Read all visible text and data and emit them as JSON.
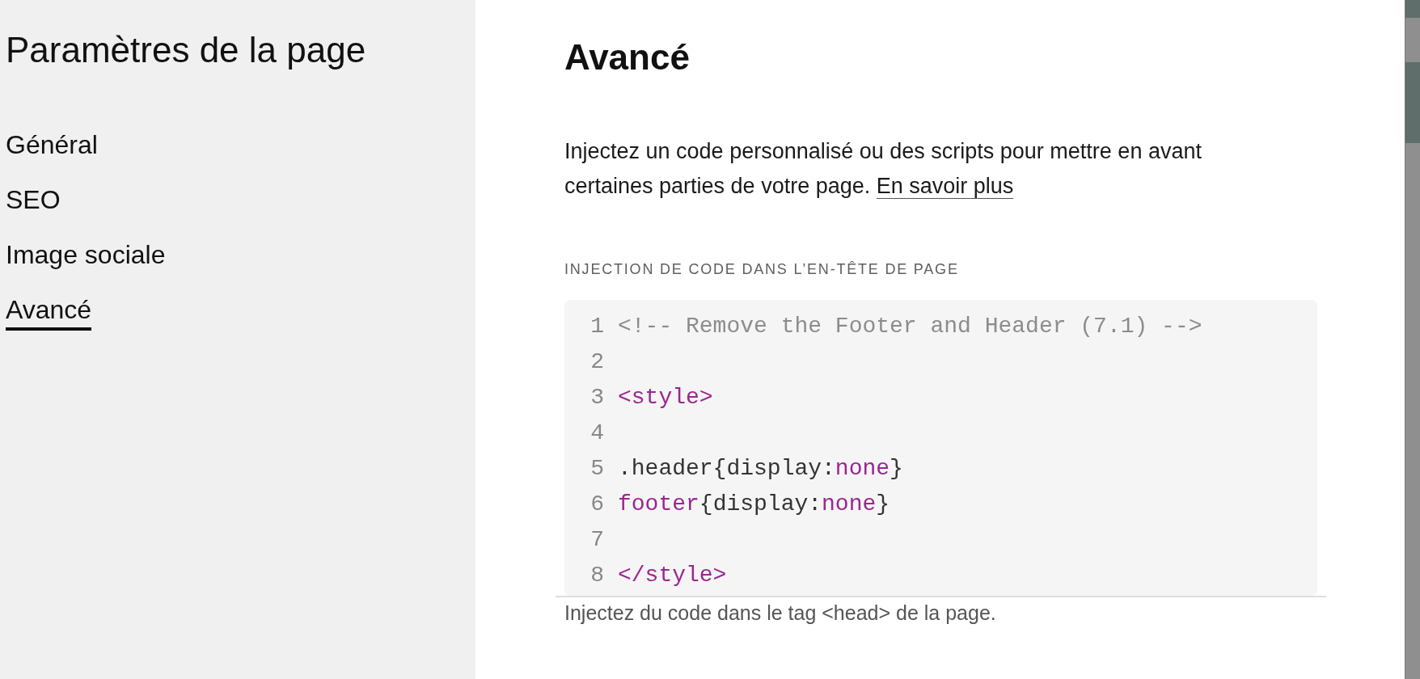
{
  "sidebar": {
    "title": "Paramètres de la page",
    "items": [
      {
        "label": "Général",
        "selected": false
      },
      {
        "label": "SEO",
        "selected": false
      },
      {
        "label": "Image sociale",
        "selected": false
      },
      {
        "label": "Avancé",
        "selected": true
      }
    ]
  },
  "panel": {
    "title": "Avancé",
    "description": "Injectez un code personnalisé ou des scripts pour mettre en avant certaines parties de votre page.",
    "link": "En savoir plus",
    "field_label": "INJECTION DE CODE DANS L’EN-TÊTE DE PAGE",
    "code_lines": [
      {
        "number": "1",
        "tokens": [
          {
            "kind": "comment",
            "text": "<!-- Remove the Footer and Header (7.1) -->"
          }
        ]
      },
      {
        "number": "2"
      },
      {
        "number": "3",
        "tokens": [
          {
            "kind": "tag",
            "text": "<style>"
          }
        ]
      },
      {
        "number": "4"
      },
      {
        "number": "5",
        "tokens": [
          {
            "kind": "plain",
            "text": ".header{display:"
          },
          {
            "kind": "keyword",
            "text": "none"
          },
          {
            "kind": "plain",
            "text": "}"
          }
        ]
      },
      {
        "number": "6",
        "tokens": [
          {
            "kind": "tag",
            "text": "footer"
          },
          {
            "kind": "plain",
            "text": "{display:"
          },
          {
            "kind": "keyword",
            "text": "none"
          },
          {
            "kind": "plain",
            "text": "}"
          }
        ]
      },
      {
        "number": "7"
      },
      {
        "number": "8",
        "tokens": [
          {
            "kind": "tag",
            "text": "</style>"
          }
        ]
      }
    ],
    "help_text": "Injectez du code dans le tag <head> de la page."
  }
}
